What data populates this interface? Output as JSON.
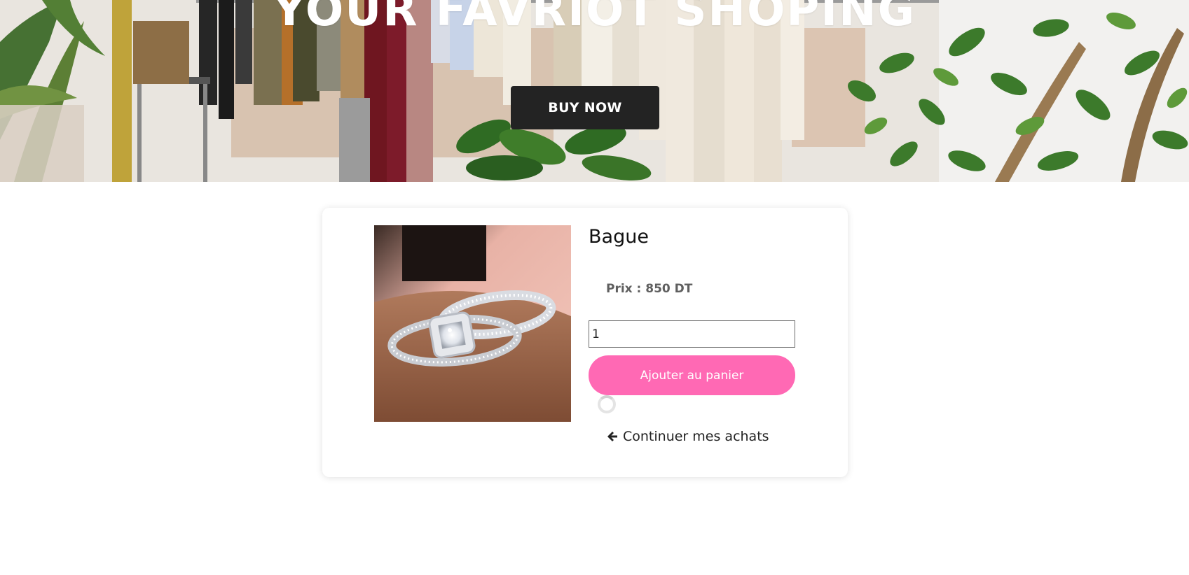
{
  "hero": {
    "title": "YOUR FAVRIOT SHOPING",
    "buy_now_label": "BUY NOW"
  },
  "product": {
    "name": "Bague",
    "price_text": "Prix : 850 DT",
    "quantity_value": "1",
    "add_to_cart_label": "Ajouter au panier",
    "continue_label": "Continuer mes achats"
  },
  "icons": {
    "continue_icon": "arrow-left-icon",
    "loading_icon": "spinner-icon"
  },
  "colors": {
    "accent_pink": "#ff69b4",
    "buy_now_bg": "#232323",
    "price_text": "#5f5f5f"
  }
}
